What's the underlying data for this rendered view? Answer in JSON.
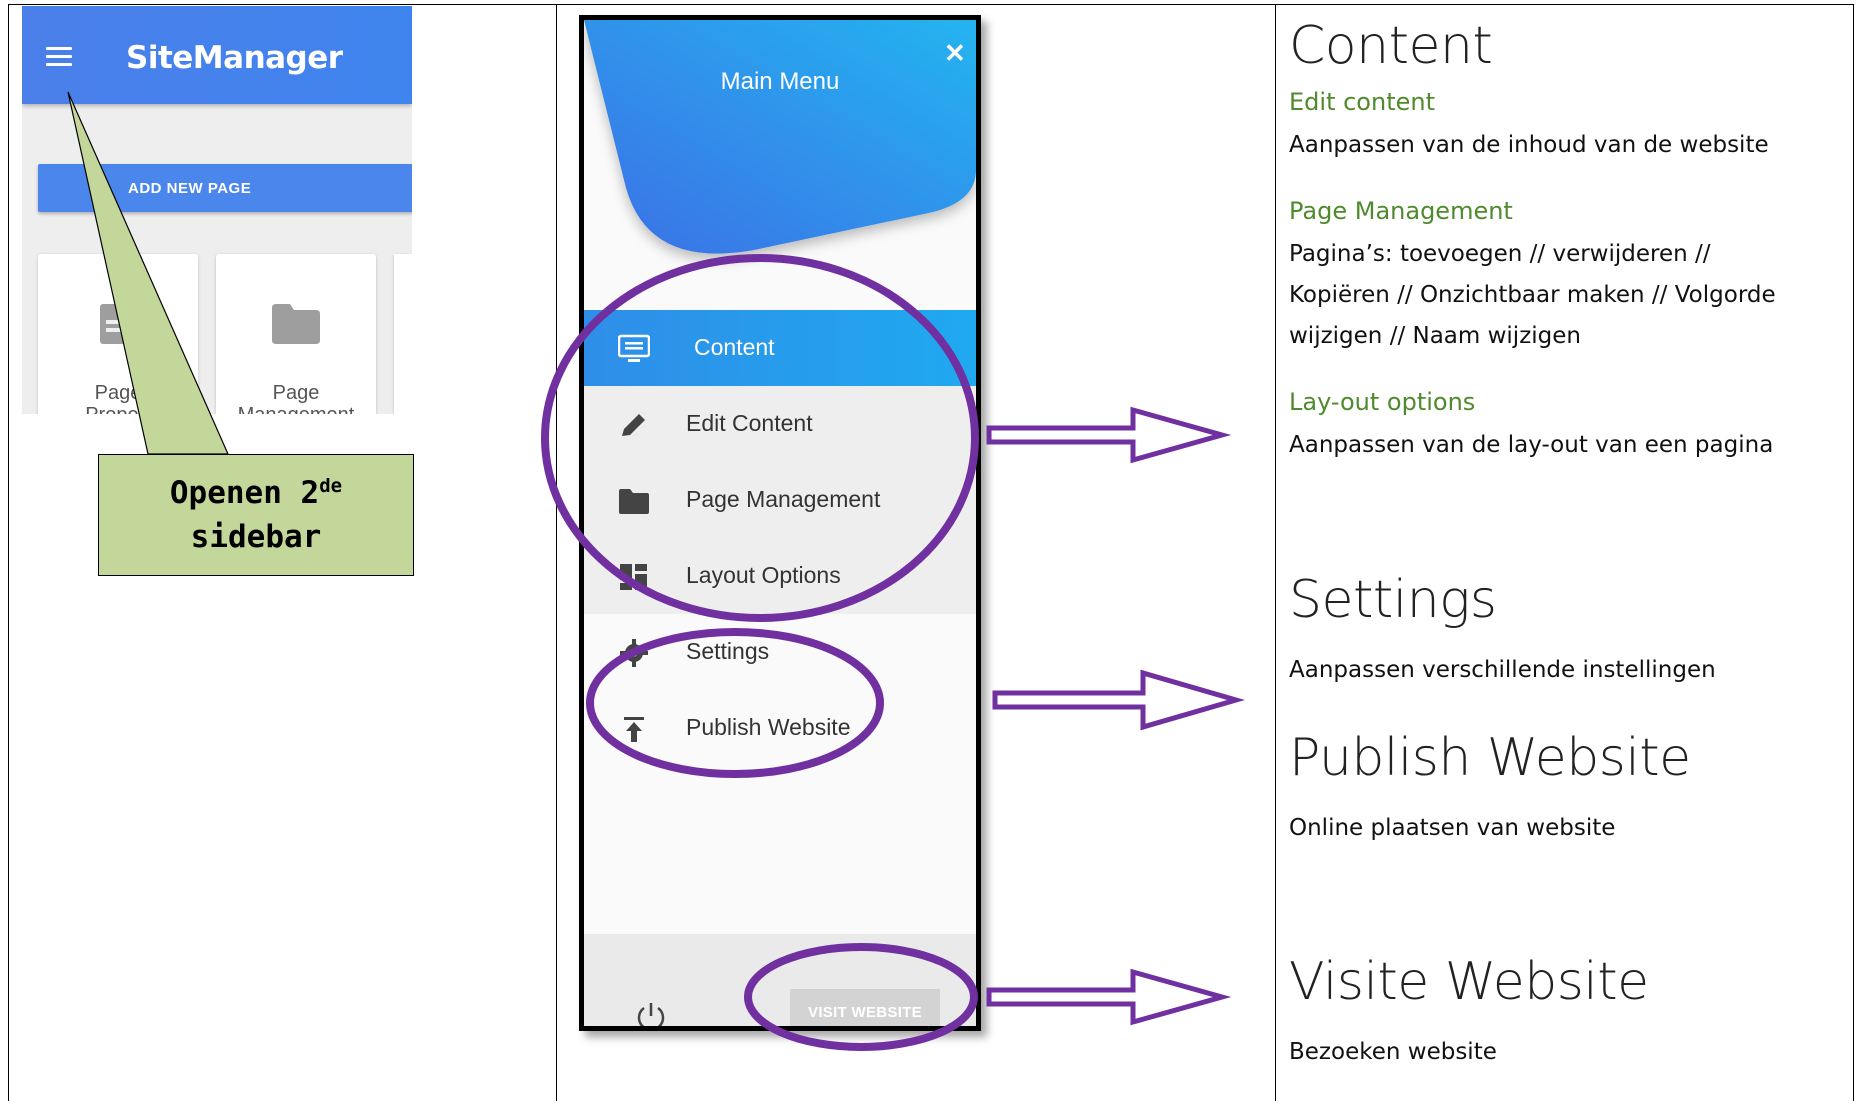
{
  "sitemanager": {
    "title": "SiteManager",
    "add_button": "ADD NEW PAGE",
    "cards": [
      {
        "label": "Page\nPropert",
        "icon": "page-properties-icon"
      },
      {
        "label": "Page\nManagement",
        "icon": "folder-icon"
      }
    ],
    "menu_icon": "hamburger-menu-icon"
  },
  "callout": {
    "text_before": "Openen 2",
    "superscript": "de",
    "text_after": "sidebar",
    "fill_color": "#c4d79b"
  },
  "main_menu": {
    "title": "Main Menu",
    "close_icon": "close-icon",
    "items": [
      {
        "label": "Content",
        "icon": "monitor-icon",
        "state": "active"
      },
      {
        "label": "Edit Content",
        "icon": "pencil-icon",
        "state": "sub"
      },
      {
        "label": "Page Management",
        "icon": "folder-icon",
        "state": "sub"
      },
      {
        "label": "Layout Options",
        "icon": "layout-icon",
        "state": "sub"
      },
      {
        "label": "Settings",
        "icon": "gear-icon",
        "state": "normal"
      },
      {
        "label": "Publish Website",
        "icon": "publish-icon",
        "state": "normal"
      }
    ],
    "footer": {
      "power_icon": "power-icon",
      "visit_button": "VISIT WEBSITE"
    },
    "accent_color": "#2196f3",
    "highlight_color": "#7030a0"
  },
  "descriptions": {
    "content": {
      "heading": "Content",
      "sections": [
        {
          "title": "Edit content",
          "lines": [
            "Aanpassen van de inhoud van de website"
          ]
        },
        {
          "title": "Page Management",
          "lines": [
            "Pagina’s: toevoegen // verwijderen //",
            "Kopiëren // Onzichtbaar maken // Volgorde",
            "wijzigen // Naam wijzigen"
          ]
        },
        {
          "title": "Lay-out options",
          "lines": [
            "Aanpassen van de lay-out van een pagina"
          ]
        }
      ]
    },
    "settings": {
      "heading": "Settings",
      "text": "Aanpassen verschillende instellingen"
    },
    "publish": {
      "heading": "Publish Website",
      "text": "Online plaatsen van website"
    },
    "visit": {
      "heading": "Visite Website",
      "text": "Bezoeken website"
    },
    "title_color": "#4f8a2c"
  }
}
